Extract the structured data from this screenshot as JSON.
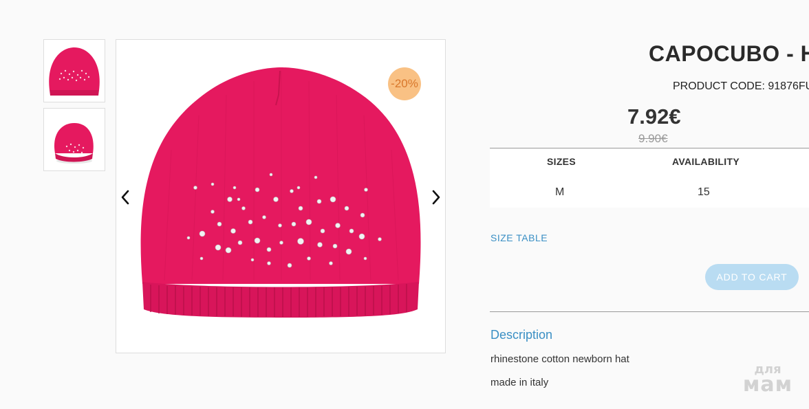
{
  "product": {
    "title": "CAPOCUBO - H",
    "code_label": "PRODUCT CODE: 91876FU",
    "price": "7.92€",
    "old_price": "9.90€",
    "discount_badge": "-20%",
    "colors": {
      "hat": "#e5195f",
      "badge_bg": "#f9c184",
      "badge_text": "#d9772b",
      "accent": "#3a8fc4"
    }
  },
  "gallery": {
    "thumbnails": [
      {
        "icon": "hat-front-thumbnail"
      },
      {
        "icon": "hat-angle-thumbnail"
      }
    ],
    "prev_icon": "chevron-left-icon",
    "next_icon": "chevron-right-icon"
  },
  "sizes_table": {
    "headers": [
      "SIZES",
      "AVAILABILITY"
    ],
    "rows": [
      [
        "M",
        "15"
      ]
    ]
  },
  "size_table_link": "SIZE TABLE",
  "add_to_cart": "ADD TO CART",
  "description": {
    "heading": "Description",
    "lines": [
      "rhinestone cotton newborn hat",
      "made in italy"
    ]
  },
  "watermark": {
    "line1": "для",
    "line2": "мам"
  }
}
